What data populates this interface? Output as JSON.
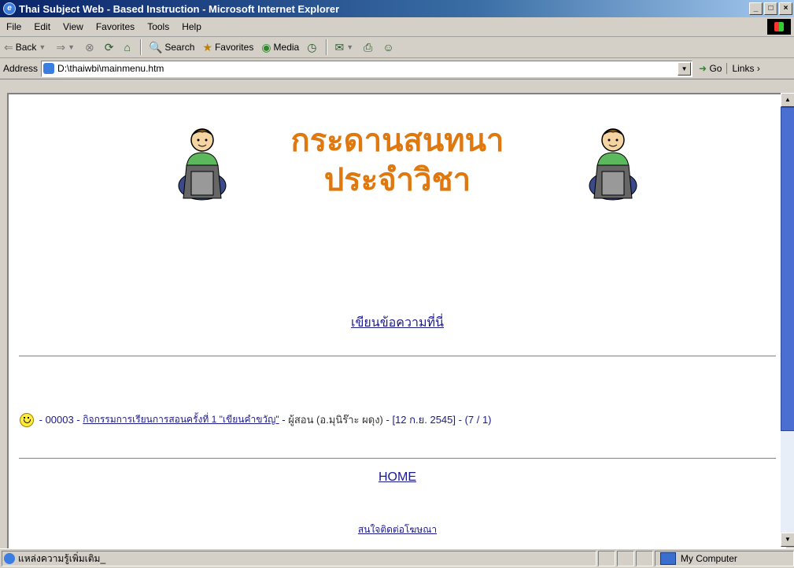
{
  "window": {
    "title": "Thai Subject Web - Based Instruction - Microsoft Internet Explorer",
    "minimize": "_",
    "maximize": "□",
    "close": "×"
  },
  "menu": {
    "file": "File",
    "edit": "Edit",
    "view": "View",
    "favorites": "Favorites",
    "tools": "Tools",
    "help": "Help"
  },
  "toolbar": {
    "back": "Back",
    "search": "Search",
    "favorites": "Favorites",
    "media": "Media"
  },
  "address": {
    "label": "Address",
    "url": "D:\\thaiwbi\\mainmenu.htm",
    "go": "Go",
    "links": "Links"
  },
  "page": {
    "heading_line1": "กระดานสนทนา",
    "heading_line2": "ประจำวิชา",
    "write_link": "เขียนข้อความที่นี่",
    "post": {
      "id": "00003",
      "title_link": "กิจกรรมการเรียนการสอนครั้งที่ 1 \"เขียนคำขวัญ\"",
      "author": "ผู้สอน (อ.มุนิร๊าะ ผดุง)",
      "date": "[12 ก.ย. 2545]",
      "counts": "(7 / 1)"
    },
    "home_link": "HOME",
    "ads_link": "สนใจติดต่อโฆษณา"
  },
  "status": {
    "text": "แหล่งความรู้เพิ่มเติม_",
    "zone": "My Computer"
  },
  "colors": {
    "heading": "#e07810",
    "link": "#1a1a8c",
    "titlebar": "#0a246a"
  }
}
